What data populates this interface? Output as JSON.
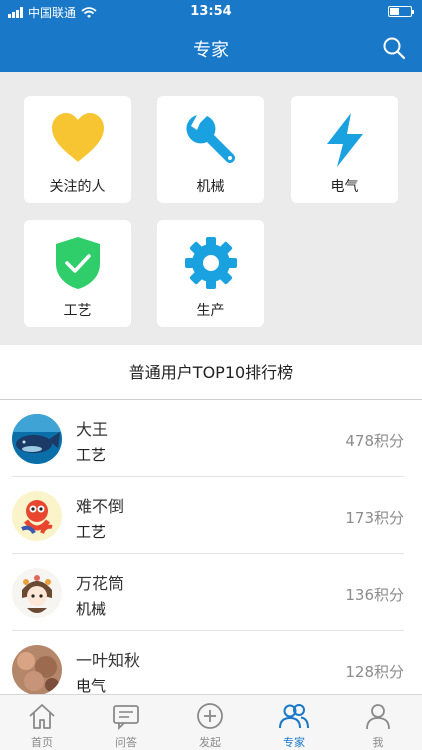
{
  "statusbar": {
    "carrier": "中国联通",
    "time": "13:54"
  },
  "header": {
    "title": "专家"
  },
  "categories": [
    {
      "label": "关注的人",
      "icon": "heart-icon",
      "color": "#f7c531"
    },
    {
      "label": "机械",
      "icon": "wrench-icon",
      "color": "#1aa1e0"
    },
    {
      "label": "电气",
      "icon": "lightning-icon",
      "color": "#1aa1e0"
    },
    {
      "label": "工艺",
      "icon": "shield-check-icon",
      "color": "#2fce6a"
    },
    {
      "label": "生产",
      "icon": "gear-icon",
      "color": "#1aa1e0"
    }
  ],
  "ranking": {
    "title": "普通用户TOP10排行榜",
    "users": [
      {
        "name": "大王",
        "category": "工艺",
        "score": "478积分"
      },
      {
        "name": "难不倒",
        "category": "工艺",
        "score": "173积分"
      },
      {
        "name": "万花筒",
        "category": "机械",
        "score": "136积分"
      },
      {
        "name": "一叶知秋",
        "category": "电气",
        "score": "128积分"
      }
    ]
  },
  "tabs": [
    {
      "label": "首页",
      "icon": "home-icon"
    },
    {
      "label": "问答",
      "icon": "chat-icon"
    },
    {
      "label": "发起",
      "icon": "plus-circle-icon"
    },
    {
      "label": "专家",
      "icon": "experts-icon",
      "active": true
    },
    {
      "label": "我",
      "icon": "user-icon"
    }
  ],
  "colors": {
    "brand": "#1a78c9",
    "inactive": "#8a8a8a"
  }
}
